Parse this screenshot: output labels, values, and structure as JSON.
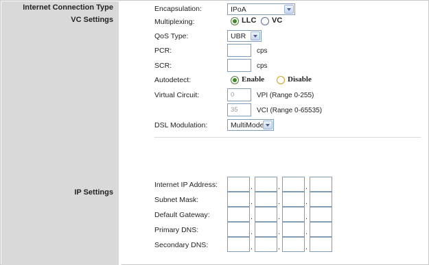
{
  "sidebar": {
    "internet_connection_type": "Internet Connection Type",
    "vc_settings": "VC Settings",
    "ip_settings": "IP Settings"
  },
  "encapsulation": {
    "label": "Encapsulation:",
    "value": "IPoA"
  },
  "multiplexing": {
    "label": "Multiplexing:",
    "options": [
      "LLC",
      "VC"
    ],
    "selected": "LLC"
  },
  "qos_type": {
    "label": "QoS Type:",
    "value": "UBR"
  },
  "pcr": {
    "label": "PCR:",
    "value": "",
    "unit": "cps"
  },
  "scr": {
    "label": "SCR:",
    "value": "",
    "unit": "cps"
  },
  "autodetect": {
    "label": "Autodetect:",
    "options": [
      "Enable",
      "Disable"
    ],
    "selected": "Enable"
  },
  "virtual_circuit": {
    "label": "Virtual Circuit:",
    "vpi_value": "0",
    "vpi_hint": "VPI (Range 0-255)",
    "vci_value": "35",
    "vci_hint": "VCI (Range 0-65535)"
  },
  "dsl_modulation": {
    "label": "DSL Modulation:",
    "value": "MultiMode"
  },
  "ip_fields": [
    {
      "label": "Internet IP Address:"
    },
    {
      "label": "Subnet Mask:"
    },
    {
      "label": "Default Gateway:"
    },
    {
      "label": "Primary DNS:"
    },
    {
      "label": "Secondary DNS:"
    }
  ],
  "ip_separator": "."
}
